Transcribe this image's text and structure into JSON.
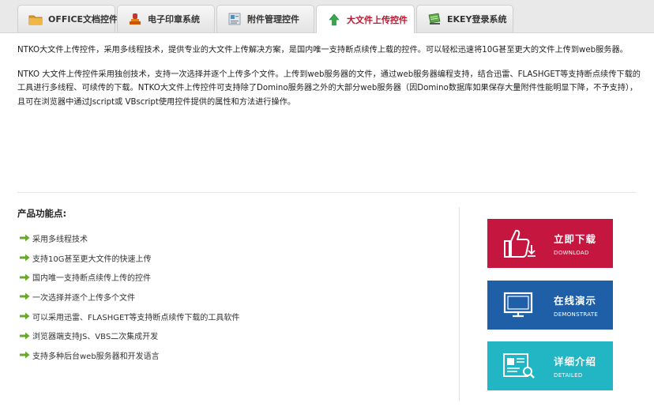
{
  "tabs": [
    {
      "label": "OFFICE文档控件",
      "icon": "folder-icon",
      "active": false
    },
    {
      "label": "电子印章系统",
      "icon": "stamp-icon",
      "active": false
    },
    {
      "label": "附件管理控件",
      "icon": "attachment-manager-icon",
      "active": false
    },
    {
      "label": "大文件上传控件",
      "icon": "upload-arrow-icon",
      "active": true
    },
    {
      "label": "EKEY登录系统",
      "icon": "ekey-keyboard-icon",
      "active": false
    }
  ],
  "intro": {
    "p1": "NTKO大文件上传控件，采用多线程技术，提供专业的大文件上传解决方案，是国内唯一支持断点续传上载的控件。可以轻松迅速将10G甚至更大的文件上传到web服务器。",
    "p2": "NTKO 大文件上传控件采用独创技术，支持一次选择并逐个上传多个文件。上传到web服务器的文件，通过web服务器编程支持，结合迅雷、FLASHGET等支持断点续传下载的工具进行多线程、可续传的下载。NTKO大文件上传控件可支持除了Domino服务器之外的大部分web服务器（因Domino数据库如果保存大量附件性能明显下降，不予支持），且可在浏览器中通过Jscript或 VBscript使用控件提供的属性和方法进行操作。"
  },
  "features": {
    "title": "产品功能点:",
    "items": [
      "采用多线程技术",
      "支持10G甚至更大文件的快速上传",
      "国内唯一支持断点续传上传的控件",
      "一次选择并逐个上传多个文件",
      "可以采用迅雷、FLASHGET等支持断点续传下载的工具软件",
      "浏览器端支持JS、VBS二次集成开发",
      "支持多种后台web服务器和开发语言"
    ]
  },
  "actions": {
    "download": {
      "label": "立即下载",
      "sub": "DOWNLOAD",
      "color": "#c4163f"
    },
    "demo": {
      "label": "在线演示",
      "sub": "DEMONSTRATE",
      "color": "#1e5fa8"
    },
    "detail": {
      "label": "详细介绍",
      "sub": "DETAILED",
      "color": "#22b5c3"
    }
  },
  "colors": {
    "active_tab_text": "#c8102e",
    "bullet_arrow": "#6aa82c"
  }
}
